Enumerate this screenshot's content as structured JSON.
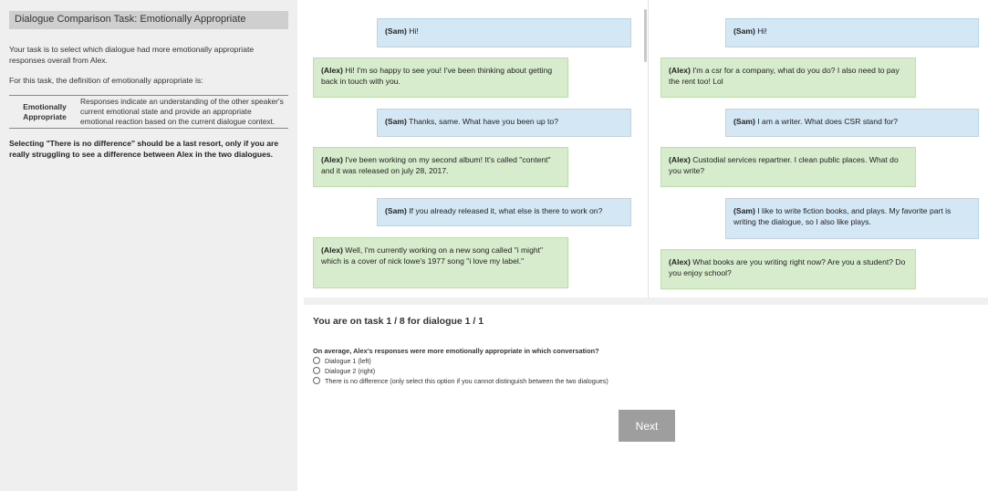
{
  "sidebar": {
    "title": "Dialogue Comparison Task: Emotionally Appropriate",
    "intro": "Your task is to select which dialogue had more emotionally appropriate responses overall from Alex.",
    "definition_intro": "For this task, the definition of emotionally appropriate is:",
    "definition": {
      "term_line1": "Emotionally",
      "term_line2": "Appropriate",
      "text": "Responses indicate an understanding of the other speaker's current emotional state and provide an appropriate emotional reaction based on the current dialogue context."
    },
    "warning": "Selecting \"There is no difference\" should be a last resort, only if you are really struggling to see a difference between Alex in the two dialogues."
  },
  "dialogue1": [
    {
      "speaker": "(Sam)",
      "text": " Hi!"
    },
    {
      "speaker": "(Alex)",
      "text": " Hi! I'm so happy to see you! I've been thinking about getting back in touch with you."
    },
    {
      "speaker": "(Sam)",
      "text": " Thanks, same. What have you been up to?"
    },
    {
      "speaker": "(Alex)",
      "text": " I've been working on my second album! It's called \"content\" and it was released on july 28, 2017."
    },
    {
      "speaker": "(Sam)",
      "text": " If you already released it, what else is there to work on?"
    },
    {
      "speaker": "(Alex)",
      "text": " Well, I'm currently working on a new song called \"i might\" which is a cover of nick lowe's 1977 song \"i love my label.\""
    }
  ],
  "dialogue2": [
    {
      "speaker": "(Sam)",
      "text": " Hi!"
    },
    {
      "speaker": "(Alex)",
      "text": " I'm a csr for a company, what do you do? I also need to pay the rent too! Lol"
    },
    {
      "speaker": "(Sam)",
      "text": " I am a writer. What does CSR stand for?"
    },
    {
      "speaker": "(Alex)",
      "text": " Custodial services repartner. I clean public places. What do you write?"
    },
    {
      "speaker": "(Sam)",
      "text": " I like to write fiction books, and plays. My favorite part is writing the dialogue, so I also like plays."
    },
    {
      "speaker": "(Alex)",
      "text": " What books are you writing right now? Are you a student? Do you enjoy school?"
    }
  ],
  "task": {
    "heading": "You are on task 1 / 8 for dialogue 1 / 1",
    "question": "On average, Alex's responses were more emotionally appropriate in which conversation?",
    "options": [
      "Dialogue 1 (left)",
      "Dialogue 2 (right)",
      "There is no difference (only select this option if you cannot distinguish between the two dialogues)"
    ],
    "next_label": "Next"
  }
}
